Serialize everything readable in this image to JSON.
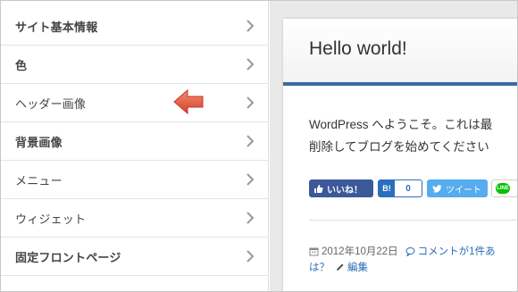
{
  "panel": {
    "items": [
      {
        "label": "サイト基本情報"
      },
      {
        "label": "色"
      },
      {
        "label": "ヘッダー画像"
      },
      {
        "label": "背景画像"
      },
      {
        "label": "メニュー"
      },
      {
        "label": "ウィジェット"
      },
      {
        "label": "固定フロントページ"
      }
    ],
    "highlight_arrow_color": "#e8634a"
  },
  "preview": {
    "post_title": "Hello world!",
    "body_line1": "WordPress へようこそ。これは最",
    "body_line2": "削除してブログを始めてください",
    "share": {
      "facebook_label": "いいね！",
      "hatena_label": "B!",
      "hatena_count": "0",
      "twitter_label": "ツイート",
      "line_label": "LINE"
    },
    "meta": {
      "date": "2012年10月22日",
      "comment_link": "コメントが1件あ",
      "continuation": "は？",
      "edit_link": "編集"
    },
    "accent_color": "#3b6ca0"
  }
}
